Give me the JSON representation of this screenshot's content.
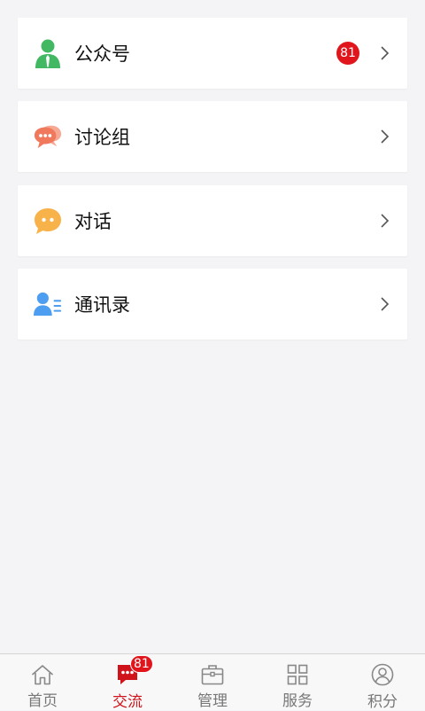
{
  "list": {
    "items": [
      {
        "label": "公众号",
        "icon": "official-account-icon",
        "badge": "81"
      },
      {
        "label": "讨论组",
        "icon": "discussion-group-icon"
      },
      {
        "label": "对话",
        "icon": "chat-bubble-icon"
      },
      {
        "label": "通讯录",
        "icon": "contacts-icon"
      }
    ]
  },
  "tabbar": {
    "tabs": [
      {
        "label": "首页",
        "icon": "home-icon"
      },
      {
        "label": "交流",
        "icon": "message-icon",
        "badge": "81",
        "active": true
      },
      {
        "label": "管理",
        "icon": "briefcase-icon"
      },
      {
        "label": "服务",
        "icon": "grid-icon"
      },
      {
        "label": "积分",
        "icon": "profile-icon"
      }
    ]
  },
  "colors": {
    "accent": "#d0121b",
    "badge": "#e0161c",
    "official_icon": "#43b863",
    "discussion_icon": "#f0785c",
    "chat_icon": "#f7b24a",
    "contacts_icon": "#4d9ef0",
    "background": "#f4f4f6"
  }
}
